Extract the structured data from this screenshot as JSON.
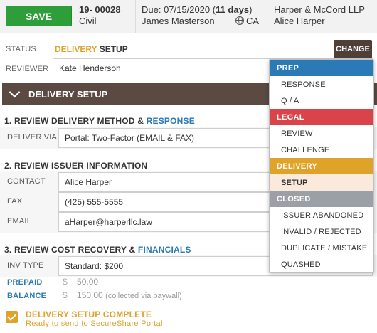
{
  "header": {
    "save_label": "SAVE",
    "case_prefix": "19-",
    "case_number": "00028",
    "case_type": "Civil",
    "due_prefix": "Due: 07/15/2020 (",
    "due_days": "11 days",
    "due_suffix": ")",
    "assignee": "James Masterson",
    "state": "CA",
    "firm": "Harper & McCord LLP",
    "client": "Alice Harper"
  },
  "status": {
    "label": "STATUS",
    "value_part1": "DELIVERY",
    "value_part2": "SETUP",
    "change_label": "CHANGE"
  },
  "reviewer": {
    "label": "REVIEWER",
    "value": "Kate Henderson"
  },
  "section": {
    "title": "DELIVERY SETUP"
  },
  "step1": {
    "title_part1": "1. REVIEW DELIVERY METHOD &",
    "title_part2": "RESPONSE",
    "deliver_via_label": "DELIVER VIA",
    "deliver_via_value": "Portal: Two-Factor (EMAIL & FAX)"
  },
  "step2": {
    "title": "2. REVIEW ISSUER INFORMATION",
    "contact_label": "CONTACT",
    "contact_value": "Alice Harper",
    "fax_label": "FAX",
    "fax_value": "(425) 555-5555",
    "email_label": "EMAIL",
    "email_value": "aHarper@harperllc.law"
  },
  "step3": {
    "title_part1": "3. REVIEW COST RECOVERY &",
    "title_part2": "FINANCIALS",
    "inv_type_label": "INV TYPE",
    "inv_type_value": "Standard: $200",
    "prepaid_label": "PREPAID",
    "prepaid_currency": "$",
    "prepaid_value": "50.00",
    "balance_label": "BALANCE",
    "balance_currency": "$",
    "balance_value": "150.00",
    "balance_note": "(collected via paywall)"
  },
  "completion": {
    "title": "DELIVERY SETUP COMPLETE",
    "subtitle": "Ready to send to SecureShare Portal"
  },
  "dropdown": {
    "groups": [
      {
        "name": "PREP",
        "color": "#2a7ab8",
        "items": [
          "RESPONSE",
          "Q / A"
        ]
      },
      {
        "name": "LEGAL",
        "color": "#d9434a",
        "items": [
          "REVIEW",
          "CHALLENGE"
        ]
      },
      {
        "name": "DELIVERY",
        "color": "#e0a32a",
        "items": [
          "SETUP"
        ]
      },
      {
        "name": "CLOSED",
        "color": "#9aa0a6",
        "items": [
          "ISSUER ABANDONED",
          "INVALID / REJECTED",
          "DUPLICATE / MISTAKE",
          "QUASHED"
        ]
      }
    ],
    "selected": "SETUP"
  }
}
